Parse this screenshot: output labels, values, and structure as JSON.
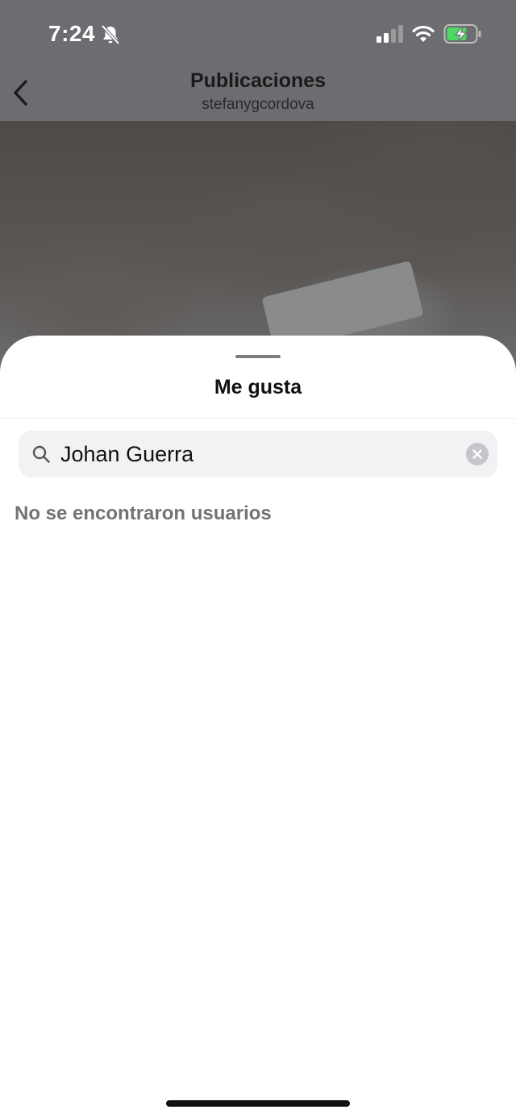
{
  "status_bar": {
    "time": "7:24",
    "icons": [
      "bell-slash-icon",
      "signal-icon",
      "wifi-icon",
      "battery-charging-icon"
    ],
    "battery_color": "#4cd964"
  },
  "nav": {
    "title": "Publicaciones",
    "subtitle": "stefanygcordova",
    "back_icon": "chevron-left-icon"
  },
  "sheet": {
    "title": "Me gusta",
    "search": {
      "value": "Johan Guerra",
      "icon": "search-icon",
      "clear_icon": "clear-icon"
    },
    "empty_message": "No se encontraron usuarios"
  },
  "colors": {
    "overlay_dim": "#6b6d70",
    "search_bg": "#f1f2f4",
    "empty_text": "#737373"
  }
}
